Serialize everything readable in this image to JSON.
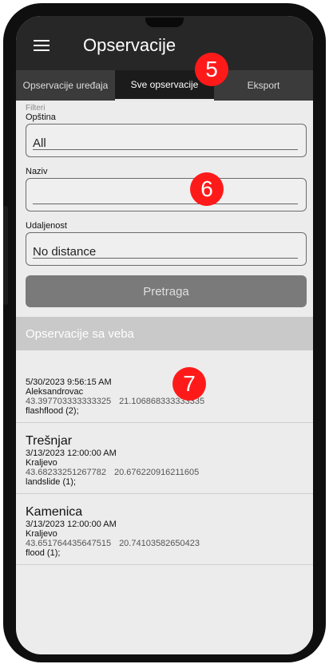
{
  "appbar": {
    "title": "Opservacije"
  },
  "tabs": [
    {
      "label": "Opservacije uređaja",
      "active": false
    },
    {
      "label": "Sve opservacije",
      "active": true
    },
    {
      "label": "Eksport",
      "active": false
    }
  ],
  "filters": {
    "heading": "Filteri",
    "opstina": {
      "label": "Opština",
      "value": "All"
    },
    "naziv": {
      "label": "Naziv",
      "value": ""
    },
    "udaljenost": {
      "label": "Udaljenost",
      "value": "No distance"
    },
    "search_label": "Pretraga"
  },
  "web_section": {
    "title": "Opservacije sa veba"
  },
  "observations": [
    {
      "name": "",
      "date": "5/30/2023 9:56:15 AM",
      "place": "Aleksandrovac",
      "lat": "43.397703333333325",
      "lon": "21.106868333333335",
      "type": "flashflood (2);"
    },
    {
      "name": "Trešnjar",
      "date": "3/13/2023 12:00:00 AM",
      "place": "Kraljevo",
      "lat": "43.68233251267782",
      "lon": "20.676220916211605",
      "type": "landslide (1);"
    },
    {
      "name": "Kamenica",
      "date": "3/13/2023 12:00:00 AM",
      "place": "Kraljevo",
      "lat": "43.651764435647515",
      "lon": "20.74103582650423",
      "type": "flood (1);"
    }
  ],
  "badges": [
    "5",
    "6",
    "7"
  ],
  "colors": {
    "appbar": "#272727",
    "badge": "#ff1a1a",
    "section": "#c9c9c9"
  }
}
